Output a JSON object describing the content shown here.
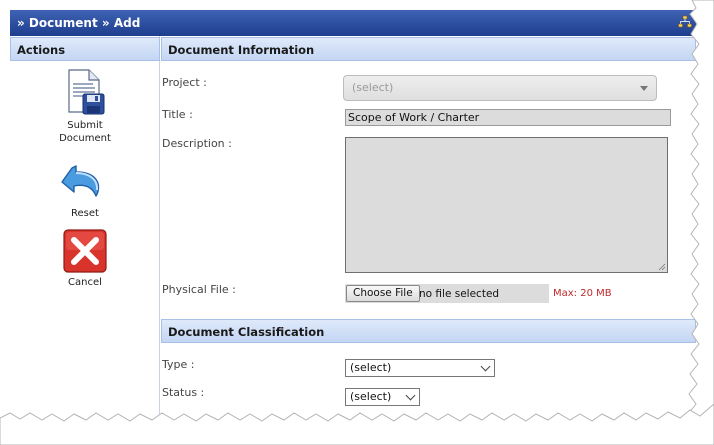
{
  "window": {
    "breadcrumb": "» Document » Add",
    "corner_icon": "sitemap-icon"
  },
  "actions": {
    "heading": "Actions",
    "items": [
      {
        "label": "Submit Document",
        "icon": "save-document-icon"
      },
      {
        "label": "Reset",
        "icon": "undo-arrow-icon"
      },
      {
        "label": "Cancel",
        "icon": "cancel-x-icon"
      }
    ]
  },
  "document_info": {
    "heading": "Document Information",
    "project": {
      "label": "Project :",
      "value": "(select)"
    },
    "title": {
      "label": "Title :",
      "value": "Scope of Work / Charter"
    },
    "description": {
      "label": "Description :",
      "value": ""
    },
    "physical_file": {
      "label": "Physical File :",
      "button_label": "Choose File",
      "status": "no file selected",
      "max_size": "Max: 20 MB"
    }
  },
  "classification": {
    "heading": "Document Classification",
    "type": {
      "label": "Type :",
      "value": "(select)"
    },
    "status": {
      "label": "Status :",
      "value": "(select)"
    }
  },
  "colors": {
    "titlebar": "#1e3e8e",
    "section_header": "#c3d6f3",
    "max_size_text": "#c0282a"
  }
}
